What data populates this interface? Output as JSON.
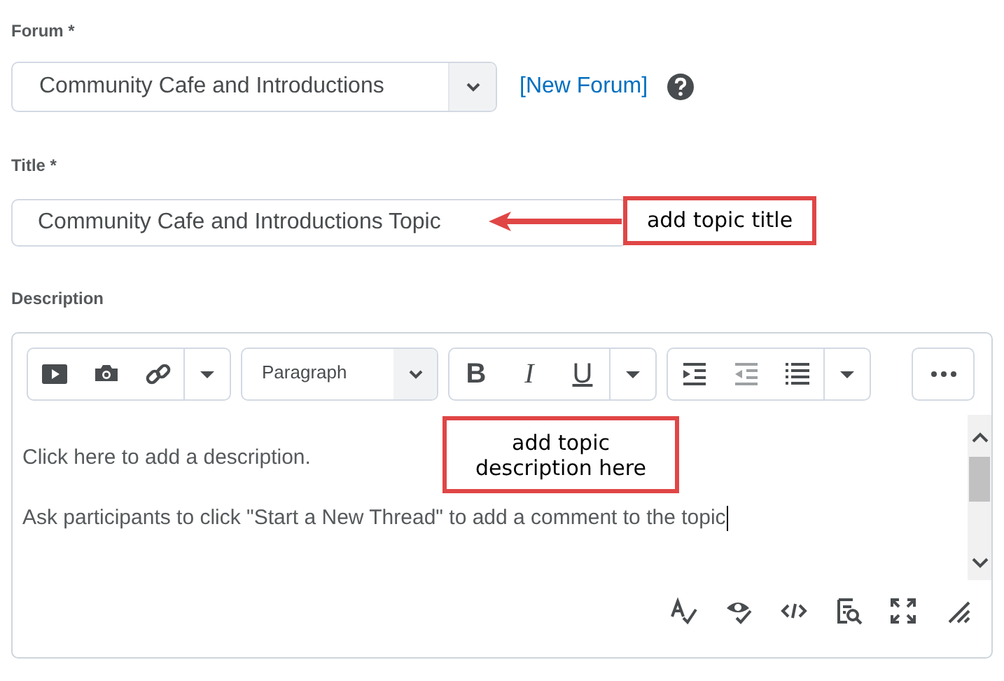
{
  "forum": {
    "label": "Forum *",
    "value": "Community Cafe and Introductions",
    "link": "[New Forum]"
  },
  "title": {
    "label": "Title *",
    "value": "Community Cafe and Introductions Topic"
  },
  "description": {
    "label": "Description",
    "toolbar": {
      "format": "Paragraph",
      "text_buttons": [
        "B",
        "I",
        "U"
      ]
    },
    "paragraphs": [
      "Click here to add a description.",
      "Ask participants to click  \"Start a New Thread\" to add a comment to the topic"
    ]
  },
  "annotations": [
    {
      "text": "add topic title",
      "arrow": true
    },
    {
      "text": "add topic\ndescription here",
      "arrow": false
    }
  ]
}
